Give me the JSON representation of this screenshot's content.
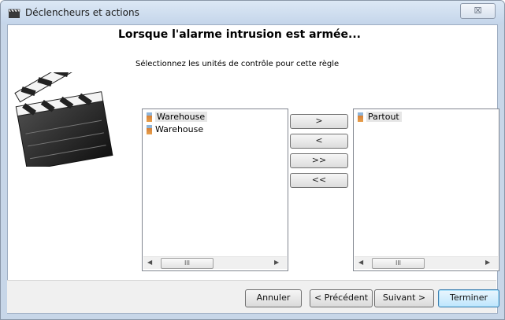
{
  "window": {
    "title": "Déclencheurs et actions",
    "close_label": "☒"
  },
  "heading": "Lorsque l'alarme intrusion est armée...",
  "instruction": "Sélectionnez les unités de contrôle pour cette règle",
  "available_list": {
    "items": [
      {
        "label": "Warehouse",
        "selected": true
      },
      {
        "label": "Warehouse",
        "selected": false
      }
    ]
  },
  "selected_list": {
    "items": [
      {
        "label": "Partout",
        "selected": true
      }
    ]
  },
  "scrollbar": {
    "left_arrow": "◀",
    "right_arrow": "▶",
    "thumb_grip": "III"
  },
  "move_buttons": {
    "add": ">",
    "remove": "<",
    "add_all": ">>",
    "remove_all": "<<"
  },
  "footer": {
    "cancel": "Annuler",
    "previous": "< Précédent",
    "next": "Suivant >",
    "finish": "Terminer"
  }
}
